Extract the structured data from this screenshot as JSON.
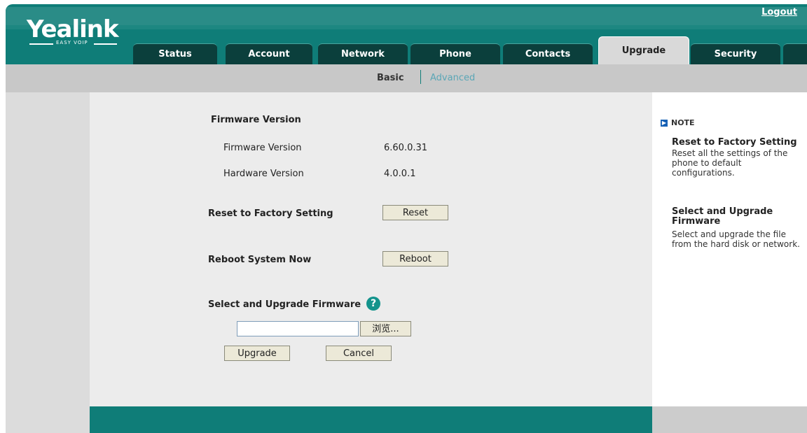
{
  "header": {
    "logo": "Yealink",
    "logo_sub": "EASY VOIP",
    "logout": "Logout",
    "tabs": [
      {
        "label": "Status"
      },
      {
        "label": "Account"
      },
      {
        "label": "Network"
      },
      {
        "label": "Phone"
      },
      {
        "label": "Contacts"
      },
      {
        "label": "Upgrade"
      },
      {
        "label": "Security"
      }
    ],
    "active_tab": "Upgrade"
  },
  "subnav": {
    "basic": "Basic",
    "advanced": "Advanced"
  },
  "main": {
    "firmware_heading": "Firmware Version",
    "firmware_label": "Firmware Version",
    "firmware_value": "6.60.0.31",
    "hardware_label": "Hardware Version",
    "hardware_value": "4.0.0.1",
    "reset_label": "Reset to Factory Setting",
    "reset_button": "Reset",
    "reboot_label": "Reboot System Now",
    "reboot_button": "Reboot",
    "upgrade_label": "Select and Upgrade Firmware",
    "help_icon": "?",
    "file_value": "",
    "browse_button": "浏览...",
    "upgrade_button": "Upgrade",
    "cancel_button": "Cancel"
  },
  "note": {
    "heading": "NOTE",
    "items": [
      {
        "title": "Reset to Factory Setting",
        "text": "Reset all the settings of the phone to default configurations."
      },
      {
        "title": "Select and Upgrade Firmware",
        "text": "Select and upgrade the file from the hard disk or network."
      }
    ]
  },
  "colors": {
    "brand_teal": "#0f7d78",
    "tab_dark": "#0b3f3c",
    "help_icon": "#13938c"
  }
}
